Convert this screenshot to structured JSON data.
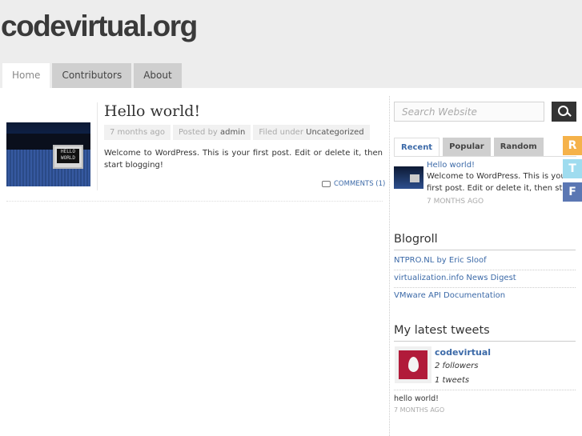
{
  "site": {
    "title": "codevirtual.org"
  },
  "nav": [
    {
      "label": "Home"
    },
    {
      "label": "Contributors"
    },
    {
      "label": "About"
    }
  ],
  "post": {
    "title": "Hello world!",
    "thumb_text": "HELLO WORLD",
    "age": "7 months ago",
    "posted_by_prefix": "Posted by",
    "author": "admin",
    "filed_prefix": "Filed under",
    "category": "Uncategorized",
    "excerpt": "Welcome to WordPress. This is your first post. Edit or delete it, then start blogging!",
    "comments": "COMMENTS (1)"
  },
  "sidebar": {
    "search_placeholder": "Search Website",
    "tabs": [
      {
        "label": "Recent"
      },
      {
        "label": "Popular"
      },
      {
        "label": "Random"
      }
    ],
    "recent": {
      "title": "Hello world!",
      "text": "Welcome to WordPress. This is your first post. Edit or delete it, then start blogging!",
      "date": "7 MONTHS AGO"
    },
    "blogroll_title": "Blogroll",
    "blogroll": [
      {
        "label": "NTPRO.NL by Eric Sloof"
      },
      {
        "label": "virtualization.info News Digest"
      },
      {
        "label": "VMware API Documentation"
      }
    ],
    "tweets_title": "My latest tweets",
    "twitter": {
      "name": "codevirtual",
      "followers": "2 followers",
      "tweets": "1 tweets",
      "tweet_text": "hello world!",
      "tweet_date": "7 MONTHS AGO"
    }
  },
  "social": [
    {
      "letter": "R",
      "color": "#f5b24a"
    },
    {
      "letter": "T",
      "color": "#9fdcef"
    },
    {
      "letter": "F",
      "color": "#5b77b3"
    }
  ]
}
